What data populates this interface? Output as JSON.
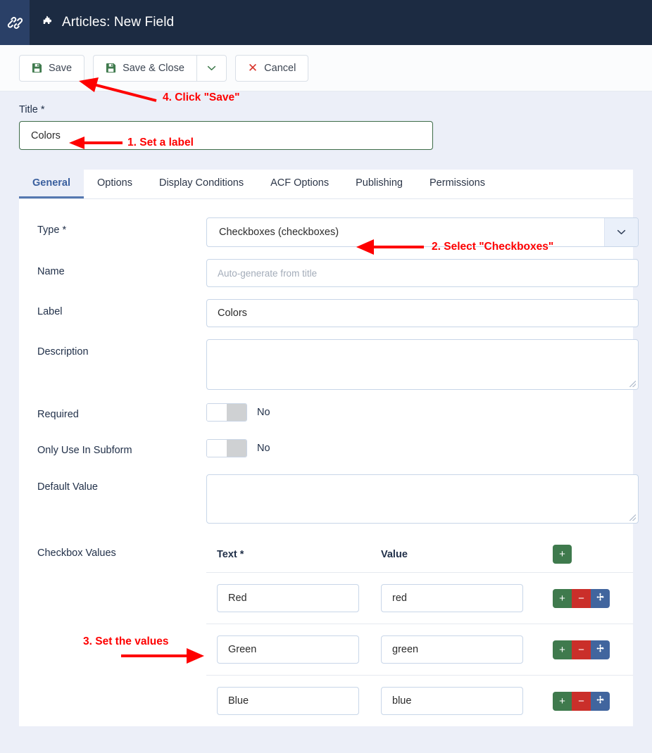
{
  "header": {
    "logo_icon": "joomla-logo-icon",
    "page_icon": "puzzle-piece-icon",
    "title": "Articles: New Field"
  },
  "toolbar": {
    "save_label": "Save",
    "save_close_label": "Save & Close",
    "cancel_label": "Cancel",
    "save_icon": "floppy-disk-icon",
    "dropdown_icon": "chevron-down-icon",
    "cancel_icon": "close-x-icon"
  },
  "title_field": {
    "label": "Title *",
    "value": "Colors"
  },
  "tabs": [
    {
      "label": "General",
      "active": true
    },
    {
      "label": "Options",
      "active": false
    },
    {
      "label": "Display Conditions",
      "active": false
    },
    {
      "label": "ACF Options",
      "active": false
    },
    {
      "label": "Publishing",
      "active": false
    },
    {
      "label": "Permissions",
      "active": false
    }
  ],
  "form": {
    "type": {
      "label": "Type *",
      "value": "Checkboxes (checkboxes)"
    },
    "name": {
      "label": "Name",
      "value": "",
      "placeholder": "Auto-generate from title"
    },
    "field_label": {
      "label": "Label",
      "value": "Colors"
    },
    "description": {
      "label": "Description",
      "value": ""
    },
    "required": {
      "label": "Required",
      "state": "No"
    },
    "only_subform": {
      "label": "Only Use In Subform",
      "state": "No"
    },
    "default_value": {
      "label": "Default Value",
      "value": ""
    }
  },
  "checkbox_values": {
    "label": "Checkbox Values",
    "columns": {
      "text": "Text *",
      "value": "Value"
    },
    "add_label": "+",
    "row_buttons": {
      "add": "+",
      "remove": "−",
      "move": "move-arrows-icon"
    },
    "rows": [
      {
        "text": "Red",
        "value": "red"
      },
      {
        "text": "Green",
        "value": "green"
      },
      {
        "text": "Blue",
        "value": "blue"
      }
    ]
  },
  "annotations": [
    {
      "id": "a4",
      "text": "4. Click \"Save\""
    },
    {
      "id": "a1",
      "text": "1. Set a label"
    },
    {
      "id": "a2",
      "text": "2. Select \"Checkboxes\""
    },
    {
      "id": "a3",
      "text": "3. Set the values"
    }
  ],
  "colors": {
    "header_bg": "#1c2b42",
    "brand_tile": "#2a4067",
    "page_bg": "#eceff8",
    "accent_blue": "#3a5f9e",
    "annotation_red": "#fe0000",
    "green": "#3f7a4d",
    "red": "#ca2f2a",
    "blue": "#41659e"
  }
}
